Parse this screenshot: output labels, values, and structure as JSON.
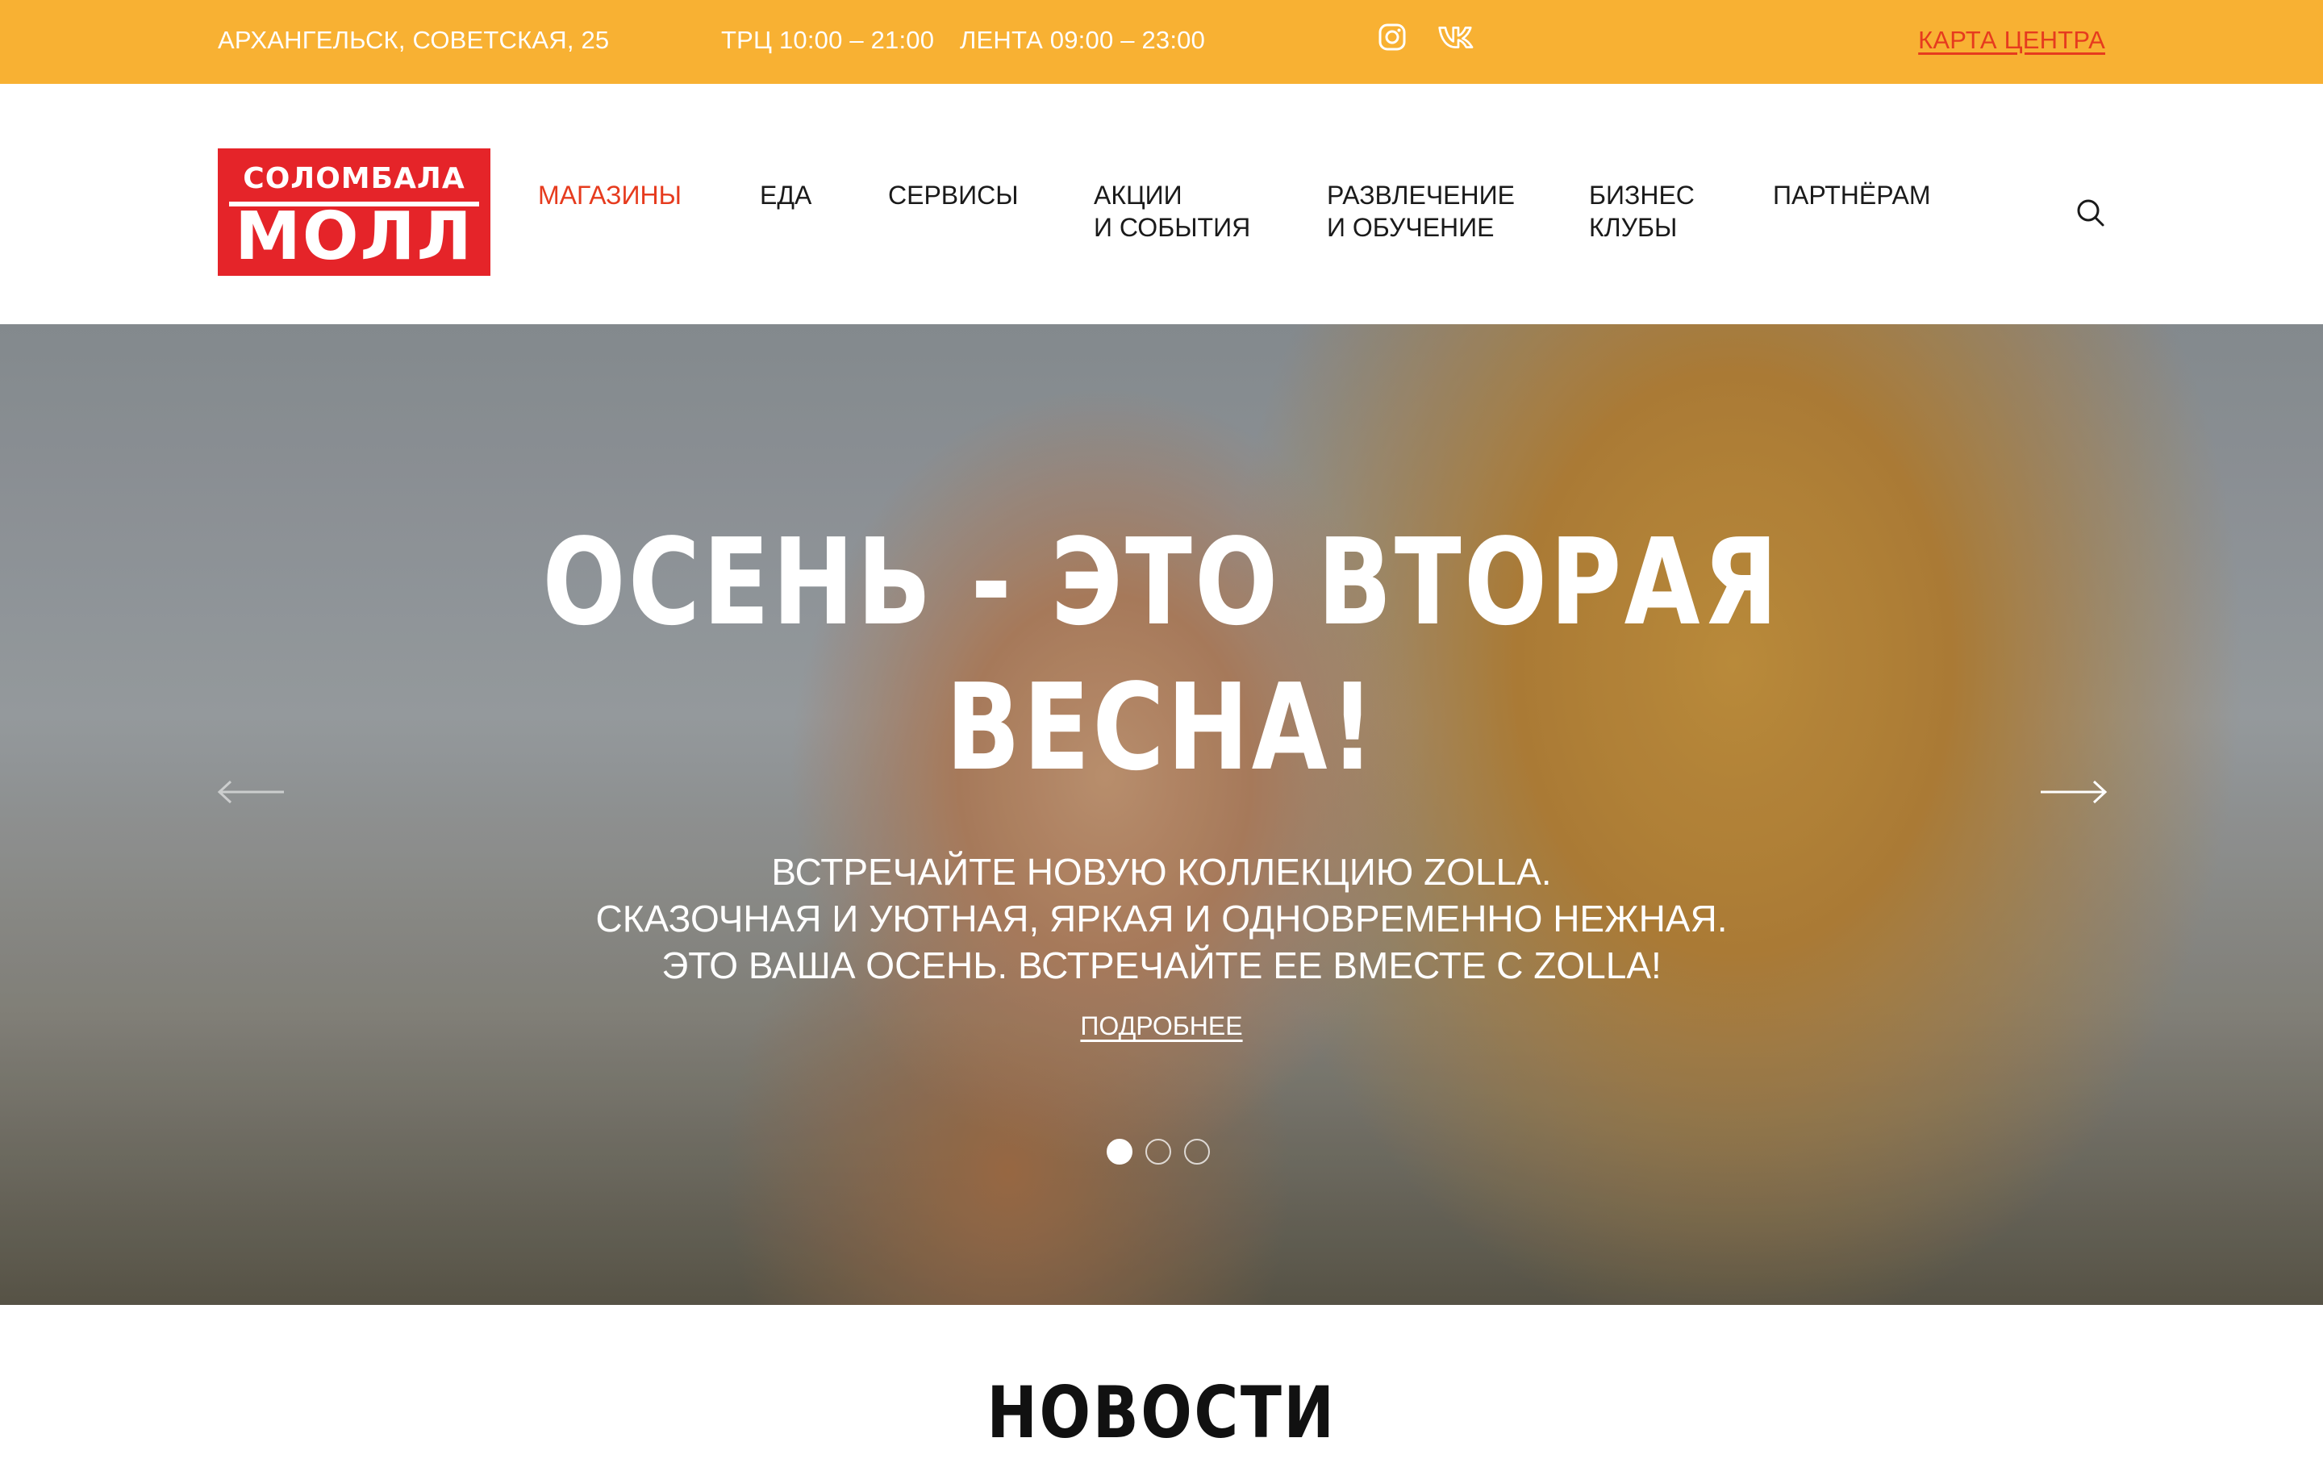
{
  "topbar": {
    "address": "АРХАНГЕЛЬСК, СОВЕТСКАЯ, 25",
    "hours_mall": "ТРЦ 10:00 – 21:00",
    "hours_lenta": "ЛЕНТА 09:00 – 23:00",
    "social": [
      "instagram-icon",
      "vk-icon"
    ],
    "map_link": "КАРТА ЦЕНТРА",
    "bg_color": "#f8b133",
    "link_color": "#e63b1e"
  },
  "logo": {
    "line1": "СОЛОМБАЛА",
    "line2": "МОЛЛ",
    "color": "#e52429"
  },
  "nav": {
    "items": [
      {
        "line1": "МАГАЗИНЫ",
        "line2": "",
        "active": true
      },
      {
        "line1": "ЕДА",
        "line2": ""
      },
      {
        "line1": "СЕРВИСЫ",
        "line2": ""
      },
      {
        "line1": "АКЦИИ",
        "line2": "И СОБЫТИЯ"
      },
      {
        "line1": "РАЗВЛЕЧЕНИЕ",
        "line2": "И ОБУЧЕНИЕ"
      },
      {
        "line1": "БИЗНЕС",
        "line2": "КЛУБЫ"
      },
      {
        "line1": "ПАРТНЁРАМ",
        "line2": ""
      }
    ],
    "search_icon": "search-icon"
  },
  "hero": {
    "title_line1": "ОСЕНЬ - ЭТО ВТОРАЯ",
    "title_line2": "ВЕСНА!",
    "sub_line1": "ВСТРЕЧАЙТЕ НОВУЮ КОЛЛЕКЦИЮ ZOLLA.",
    "sub_line2": "СКАЗОЧНАЯ И УЮТНАЯ, ЯРКАЯ И ОДНОВРЕМЕННО НЕЖНАЯ.",
    "sub_line3": "ЭТО ВАША ОСЕНЬ. ВСТРЕЧАЙТЕ ЕЕ ВМЕСТЕ С ZOLLA!",
    "more_link": "ПОДРОБНЕЕ",
    "prev_icon": "arrow-left-icon",
    "next_icon": "arrow-right-icon",
    "slides_total": 3,
    "slide_active": 1
  },
  "news": {
    "title": "НОВОСТИ"
  }
}
